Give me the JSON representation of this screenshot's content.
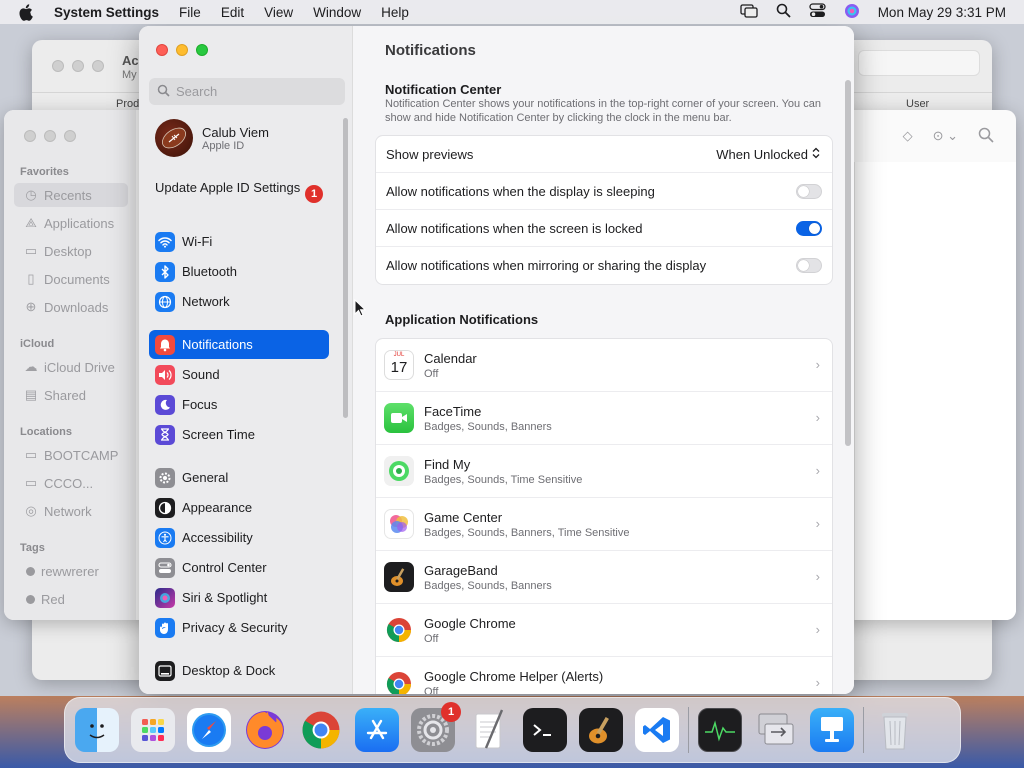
{
  "menubar": {
    "app": "System Settings",
    "items": [
      "File",
      "Edit",
      "View",
      "Window",
      "Help"
    ],
    "clock": "Mon May 29  3:31 PM"
  },
  "back_window": {
    "title": "Ac",
    "sub": "My",
    "col1": "Prod",
    "col2": "User"
  },
  "finder": {
    "sections": {
      "favorites": "Favorites",
      "icloud": "iCloud",
      "locations": "Locations",
      "tags": "Tags"
    },
    "favorites": [
      "Recents",
      "Applications",
      "Desktop",
      "Documents",
      "Downloads"
    ],
    "icloud": [
      "iCloud Drive",
      "Shared"
    ],
    "locations": [
      "BOOTCAMP",
      "CCCO...",
      "Network"
    ],
    "tags": [
      "rewwrerer",
      "Red"
    ]
  },
  "sidebar": {
    "search_placeholder": "Search",
    "profile": {
      "name": "Calub Viem",
      "sub": "Apple ID"
    },
    "update": {
      "label": "Update Apple ID Settings",
      "badge": "1"
    },
    "items": [
      {
        "label": "Wi-Fi",
        "icon": "wifi-icon",
        "color": "#1a7bf2"
      },
      {
        "label": "Bluetooth",
        "icon": "bluetooth-icon",
        "color": "#1a7bf2"
      },
      {
        "label": "Network",
        "icon": "globe-icon",
        "color": "#1a7bf2"
      },
      {
        "label": "Notifications",
        "icon": "bell-icon",
        "color": "#f24a3d",
        "active": true
      },
      {
        "label": "Sound",
        "icon": "speaker-icon",
        "color": "#f24a5a"
      },
      {
        "label": "Focus",
        "icon": "moon-icon",
        "color": "#5b4ad6"
      },
      {
        "label": "Screen Time",
        "icon": "hourglass-icon",
        "color": "#5b4ad6"
      },
      {
        "label": "General",
        "icon": "gear-icon",
        "color": "#8e8e93"
      },
      {
        "label": "Appearance",
        "icon": "appearance-icon",
        "color": "#1d1d1f"
      },
      {
        "label": "Accessibility",
        "icon": "accessibility-icon",
        "color": "#1a7bf2"
      },
      {
        "label": "Control Center",
        "icon": "control-center-icon",
        "color": "#8e8e93"
      },
      {
        "label": "Siri & Spotlight",
        "icon": "siri-icon",
        "color": "#c73aa8"
      },
      {
        "label": "Privacy & Security",
        "icon": "hand-icon",
        "color": "#1a7bf2"
      },
      {
        "label": "Desktop & Dock",
        "icon": "dock-icon",
        "color": "#1d1d1f"
      }
    ]
  },
  "main": {
    "title": "Notifications",
    "nc_title": "Notification Center",
    "nc_desc": "Notification Center shows your notifications in the top-right corner of your screen. You can show and hide Notification Center by clicking the clock in the menu bar.",
    "show_previews": {
      "label": "Show previews",
      "value": "When Unlocked"
    },
    "toggles": [
      {
        "label": "Allow notifications when the display is sleeping",
        "on": false
      },
      {
        "label": "Allow notifications when the screen is locked",
        "on": true
      },
      {
        "label": "Allow notifications when mirroring or sharing the display",
        "on": false
      }
    ],
    "apps_title": "Application Notifications",
    "apps": [
      {
        "name": "Calendar",
        "sub": "Off",
        "icon": "calendar-icon",
        "cal_month": "JUL",
        "cal_day": "17"
      },
      {
        "name": "FaceTime",
        "sub": "Badges, Sounds, Banners",
        "icon": "facetime-icon"
      },
      {
        "name": "Find My",
        "sub": "Badges, Sounds, Time Sensitive",
        "icon": "findmy-icon"
      },
      {
        "name": "Game Center",
        "sub": "Badges, Sounds, Banners, Time Sensitive",
        "icon": "gamecenter-icon"
      },
      {
        "name": "GarageBand",
        "sub": "Badges, Sounds, Banners",
        "icon": "garageband-icon"
      },
      {
        "name": "Google Chrome",
        "sub": "Off",
        "icon": "chrome-icon"
      },
      {
        "name": "Google Chrome Helper (Alerts)",
        "sub": "Off",
        "icon": "chrome-icon"
      }
    ]
  },
  "dock": {
    "settings_badge": "1"
  }
}
